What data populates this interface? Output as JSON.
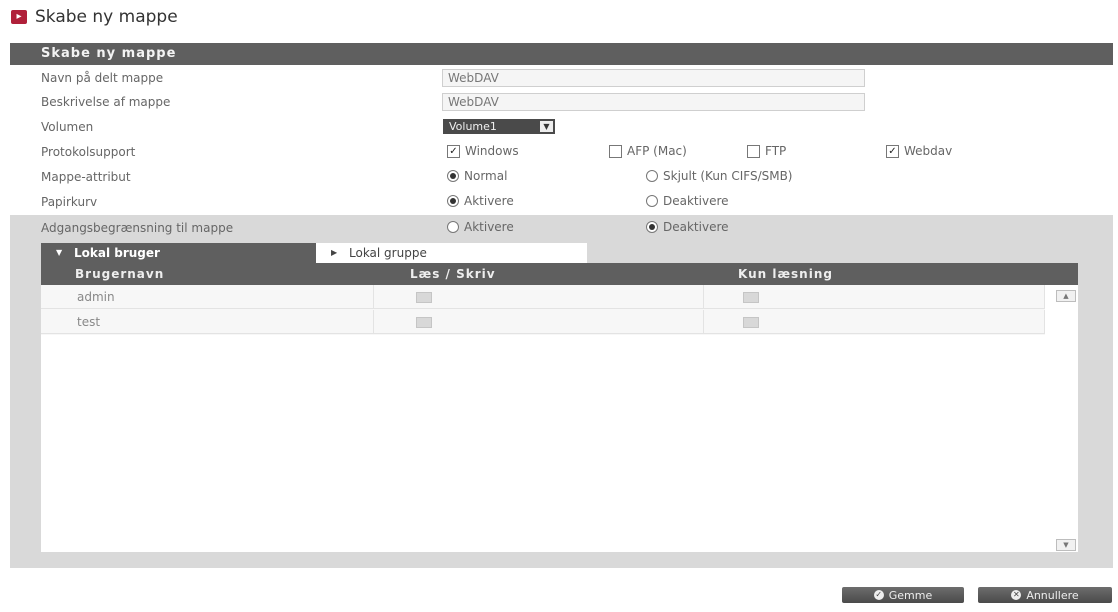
{
  "page": {
    "title": "Skabe ny mappe",
    "title_icon": "arrow-right-icon"
  },
  "panel": {
    "header": "Skabe ny mappe"
  },
  "form": {
    "name": {
      "label": "Navn på delt mappe",
      "value": "WebDAV"
    },
    "description": {
      "label": "Beskrivelse af mappe",
      "value": "WebDAV"
    },
    "volume": {
      "label": "Volumen",
      "value": "Volume1"
    },
    "protocol": {
      "label": "Protokolsupport",
      "options": [
        {
          "label": "Windows",
          "checked": true
        },
        {
          "label": "AFP (Mac)",
          "checked": false
        },
        {
          "label": "FTP",
          "checked": false
        },
        {
          "label": "Webdav",
          "checked": true
        }
      ]
    },
    "attribute": {
      "label": "Mappe-attribut",
      "options": [
        {
          "label": "Normal",
          "selected": true
        },
        {
          "label": "Skjult (Kun CIFS/SMB)",
          "selected": false
        }
      ]
    },
    "recycle": {
      "label": "Papirkurv",
      "options": [
        {
          "label": "Aktivere",
          "selected": true
        },
        {
          "label": "Deaktivere",
          "selected": false
        }
      ]
    },
    "access": {
      "label": "Adgangsbegrænsning til mappe",
      "options": [
        {
          "label": "Aktivere",
          "selected": false
        },
        {
          "label": "Deaktivere",
          "selected": true
        }
      ]
    }
  },
  "tabs": {
    "user": "Lokal bruger",
    "group": "Lokal gruppe"
  },
  "table": {
    "headers": [
      "Brugernavn",
      "Læs / Skriv",
      "Kun læsning"
    ],
    "rows": [
      {
        "name": "admin"
      },
      {
        "name": "test"
      }
    ]
  },
  "buttons": {
    "save": "Gemme",
    "cancel": "Annullere"
  },
  "colors": {
    "accent": "#b0203a",
    "header_bg": "#5f5f5f",
    "area_bg": "#d9d9d9"
  }
}
